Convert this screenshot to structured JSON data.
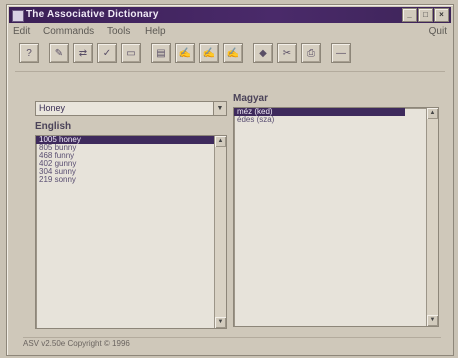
{
  "window": {
    "title": "The Associative Dictionary"
  },
  "window_buttons": [
    "_",
    "□",
    "×"
  ],
  "menu": {
    "items": [
      "Edit",
      "Commands",
      "Tools",
      "Help"
    ],
    "right": "Quit"
  },
  "toolbar": {
    "tools": [
      {
        "icon": "help-icon",
        "glyph": "?"
      },
      {
        "icon": "copy-word-icon",
        "glyph": "✎"
      },
      {
        "icon": "link-icon",
        "glyph": "⇄"
      },
      {
        "icon": "lookup-icon",
        "glyph": "✓"
      },
      {
        "icon": "card-icon",
        "glyph": "▭"
      },
      {
        "icon": "dictionary-icon",
        "glyph": "▤"
      },
      {
        "icon": "add-word-icon",
        "glyph": "✍"
      },
      {
        "icon": "edit-word-icon",
        "glyph": "✍"
      },
      {
        "icon": "delete-word-icon",
        "glyph": "✍"
      },
      {
        "icon": "eye-icon",
        "glyph": "◆"
      },
      {
        "icon": "scissors-icon",
        "glyph": "✂"
      },
      {
        "icon": "print-icon",
        "glyph": "⎙"
      },
      {
        "icon": "minus-icon",
        "glyph": "—"
      }
    ]
  },
  "left_panel": {
    "combo_value": "Honey",
    "label": "English",
    "items": [
      {
        "text": "1005 honey",
        "selected": true
      },
      {
        "text": "805 bunny",
        "selected": false
      },
      {
        "text": "468 funny",
        "selected": false
      },
      {
        "text": "402 gunny",
        "selected": false
      },
      {
        "text": "304 sunny",
        "selected": false
      },
      {
        "text": "219 sonny",
        "selected": false
      }
    ]
  },
  "right_panel": {
    "label": "Magyar",
    "items": [
      {
        "text": "méz (ked)",
        "selected": true
      },
      {
        "text": "édes (sza)",
        "selected": false
      }
    ]
  },
  "status": {
    "text": "ASV v2.50e Copyright © 1996"
  }
}
